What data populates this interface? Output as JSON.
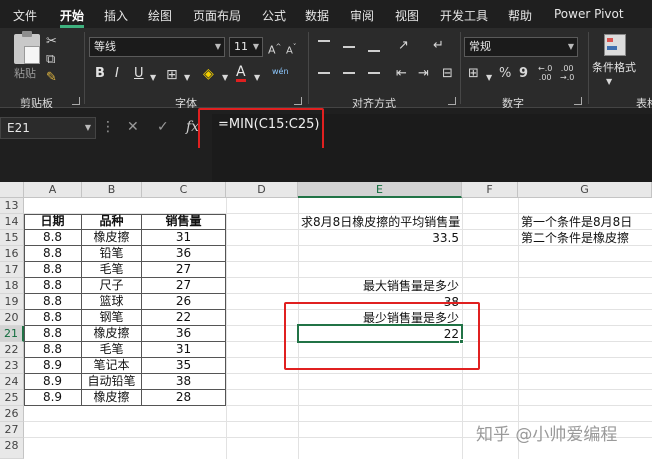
{
  "ribbon": {
    "tabs": [
      "文件",
      "开始",
      "插入",
      "绘图",
      "页面布局",
      "公式",
      "数据",
      "审阅",
      "视图",
      "开发工具",
      "帮助",
      "Power Pivot"
    ],
    "active_tab": "开始",
    "groups": {
      "clipboard": "剪贴板",
      "font": "字体",
      "alignment": "对齐方式",
      "number": "数字",
      "styles_partial": "表格"
    },
    "paste_label": "粘贴",
    "font_name": "等线",
    "font_size": "11",
    "number_format": "常规",
    "conditional_format": "条件格式",
    "bold": "B",
    "italic": "I",
    "underline": "U",
    "wrap_label": "wén",
    "font_color_glyph": "A",
    "percent": "%",
    "comma": "9",
    "inc_decimal": "←.0\n.00",
    "dec_decimal": ".00\n→.0",
    "grow_font": "A^",
    "shrink_font": "A˅"
  },
  "formula_bar": {
    "name_box": "E21",
    "fx": "fx",
    "formula": "=MIN(C15:C25)"
  },
  "sheet": {
    "columns": [
      "A",
      "B",
      "C",
      "D",
      "E",
      "F",
      "G"
    ],
    "active_column": "E",
    "rows": [
      "13",
      "14",
      "15",
      "16",
      "17",
      "18",
      "19",
      "20",
      "21",
      "22",
      "23",
      "24",
      "25",
      "26",
      "27",
      "28"
    ],
    "active_row": "21",
    "table": {
      "headers": [
        "日期",
        "品种",
        "销售量"
      ],
      "rows": [
        [
          "8.8",
          "橡皮擦",
          "31"
        ],
        [
          "8.8",
          "铅笔",
          "36"
        ],
        [
          "8.8",
          "毛笔",
          "27"
        ],
        [
          "8.8",
          "尺子",
          "27"
        ],
        [
          "8.8",
          "篮球",
          "26"
        ],
        [
          "8.8",
          "钢笔",
          "22"
        ],
        [
          "8.8",
          "橡皮擦",
          "36"
        ],
        [
          "8.8",
          "毛笔",
          "31"
        ],
        [
          "8.9",
          "笔记本",
          "35"
        ],
        [
          "8.9",
          "自动铅笔",
          "38"
        ],
        [
          "8.9",
          "橡皮擦",
          "28"
        ]
      ]
    },
    "notes": {
      "e14": "求8月8日橡皮擦的平均销售量",
      "e15": "33.5",
      "e18": "最大销售量是多少",
      "e19": "38",
      "e20": "最少销售量是多少",
      "e21": "22",
      "g14": "第一个条件是8月8日",
      "g15": "第二个条件是橡皮擦"
    }
  },
  "watermark": "知乎 @小帅爱编程",
  "colors": {
    "accent_green": "#217346",
    "highlight_red": "#e02020",
    "ribbon_dark": "#2b2b2b"
  }
}
